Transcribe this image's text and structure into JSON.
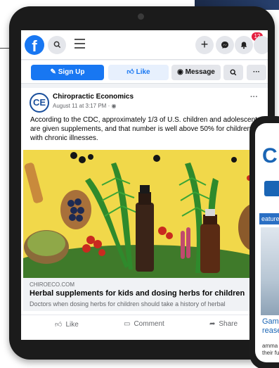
{
  "topbar": {
    "logo_letter": "f",
    "search_icon": "search-icon",
    "menu_icon": "hamburger-icon",
    "plus_icon": "plus-icon",
    "messenger_icon": "messenger-icon",
    "notifications_icon": "bell-icon",
    "notification_count": "12"
  },
  "actions": {
    "sign_up": "Sign Up",
    "like": "Like",
    "message": "Message",
    "search_icon": "search-icon",
    "more": "···"
  },
  "post": {
    "page_avatar": "CE",
    "page_name": "Chiropractic Economics",
    "date": "August 11 at 3:17 PM · ◉",
    "menu": "···",
    "text_lines": [
      "According to the CDC, approximately 1/3 of U.S. children and adolescents",
      "are given supplements, and that number is well above 50% for children",
      "with chronic illnesses."
    ],
    "link": {
      "domain": "CHIROECO.COM",
      "title": "Herbal supplements for kids and dosing herbs for children",
      "description": "Doctors when dosing herbs for children should take a history of herbal"
    },
    "reactions": {
      "like": "Like",
      "comment": "Comment",
      "share": "Share"
    }
  },
  "phone": {
    "logo": "C",
    "tag": "eatured",
    "title_lines": [
      "Gam",
      "rease"
    ],
    "desc_lines": [
      "amma cry",
      "their fu"
    ]
  },
  "colors": {
    "facebook_blue": "#1877f2",
    "notification_red": "#e41e3f",
    "image_background": "#f1d84a"
  }
}
